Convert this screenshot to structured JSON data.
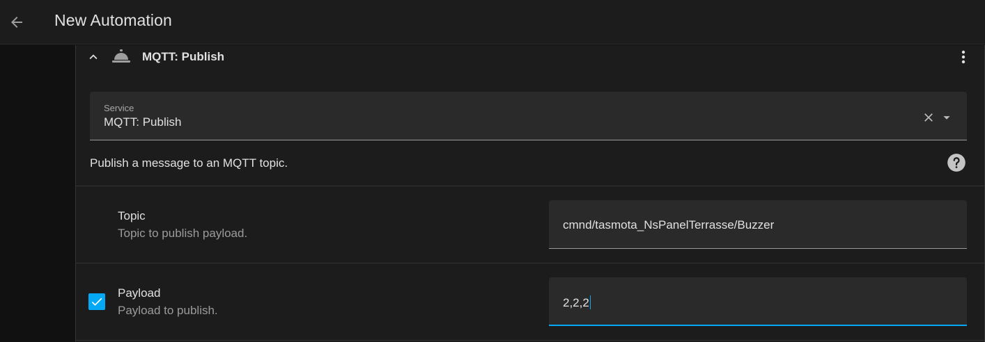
{
  "header": {
    "title": "New Automation",
    "back_icon": "arrow-left-icon"
  },
  "action": {
    "title": "MQTT: Publish",
    "icons": [
      "chevron-up-icon",
      "service-bell-icon",
      "dots-vertical-icon"
    ]
  },
  "service": {
    "label": "Service",
    "value": "MQTT: Publish",
    "icons": [
      "close-icon",
      "menu-down-icon"
    ]
  },
  "description": "Publish a message to an MQTT topic.",
  "help_icon": "help-circle-icon",
  "params": [
    {
      "name": "Topic",
      "description": "Topic to publish payload.",
      "value": "cmnd/tasmota_NsPanelTerrasse/Buzzer",
      "checkbox": false,
      "focused": false
    },
    {
      "name": "Payload",
      "description": "Payload to publish.",
      "value": "2,2,2",
      "checkbox": true,
      "checked": true,
      "focused": true
    }
  ],
  "colors": {
    "accent": "#03a9f4",
    "background": "#111111",
    "card": "#1c1c1c",
    "field": "#2a2a2a",
    "text": "#e1e1e1",
    "secondary_text": "#9b9b9b"
  }
}
